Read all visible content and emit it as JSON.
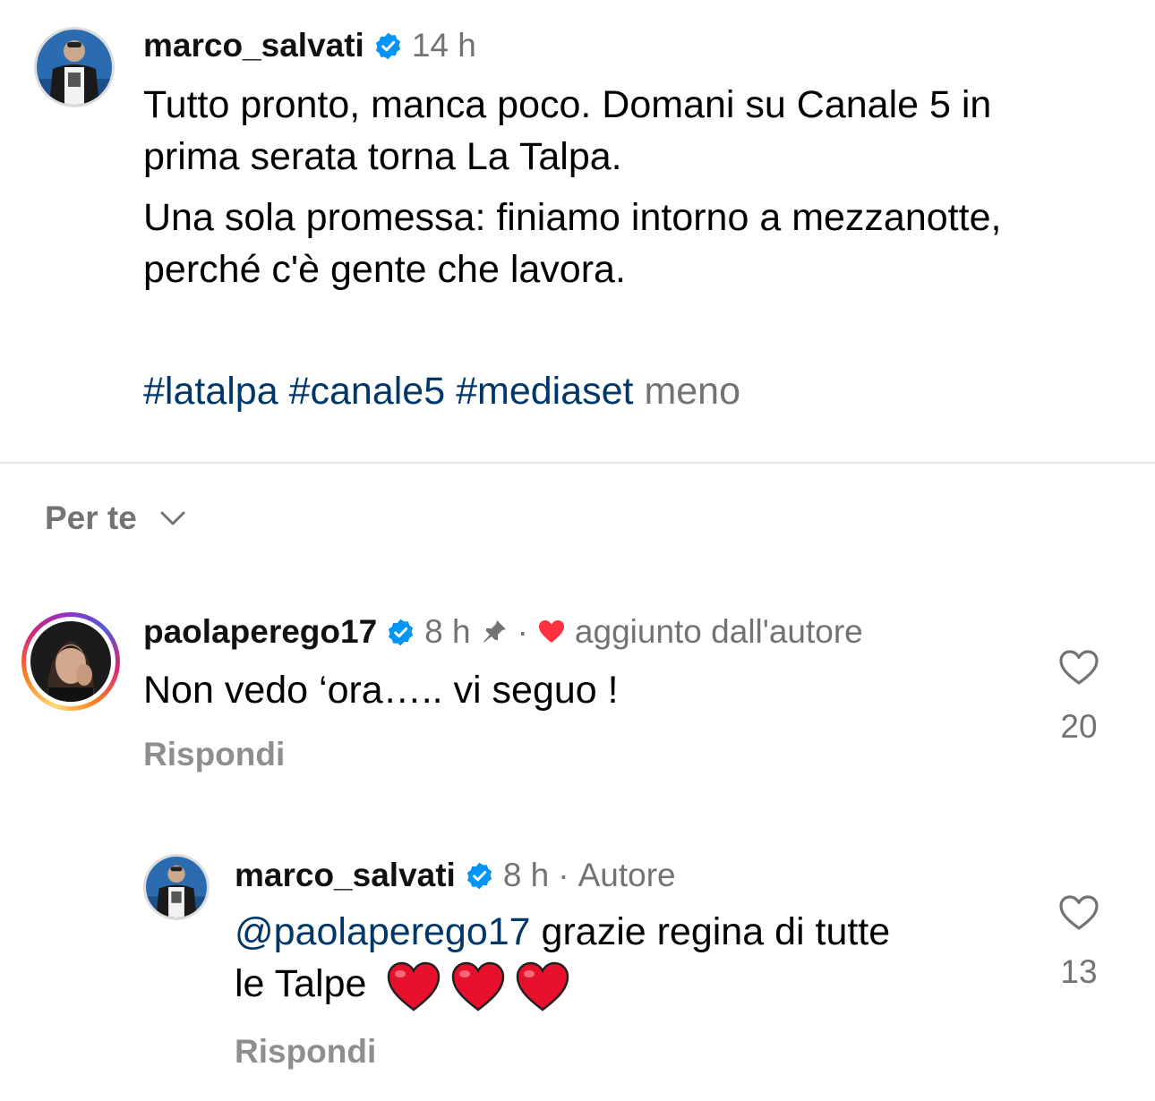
{
  "colors": {
    "verified_blue": "#0095f6",
    "hashtag_blue": "#00376b",
    "muted_gray": "#737373",
    "reply_gray": "#8e8e8e",
    "heart_red": "#ff3040"
  },
  "caption": {
    "avatar_icon": "profile-photo",
    "username": "marco_salvati",
    "verified_icon": "verified-badge-icon",
    "time": "14 h",
    "text_line1": "Tutto pronto, manca poco. Domani su Canale 5 in",
    "text_line2": "prima serata torna La Talpa.",
    "text_line3": "Una sola promessa: finiamo intorno a mezzanotte,",
    "text_line4": "perché c'è gente che lavora.",
    "hashtags": [
      "#latalpa",
      "#canale5",
      "#mediaset"
    ],
    "less_label": "meno"
  },
  "sort": {
    "label": "Per te",
    "icon": "chevron-down-icon"
  },
  "comments": [
    {
      "username": "paolaperego17",
      "time": "8 h",
      "pinned_icon": "pin-icon",
      "separator": "·",
      "heart_icon": "heart-filled-icon",
      "author_like_label": "aggiunto dall'autore",
      "text": "Non vedo ‘ora….. vi seguo !",
      "reply_label": "Rispondi",
      "like_count": "20"
    },
    {
      "username": "marco_salvati",
      "time": "8 h",
      "separator": "·",
      "author_label": "Autore",
      "mention": "@paolaperego17",
      "text_after_mention": " grazie regina di tutte",
      "text_line2": "le Talpe",
      "emoji_hearts": 3,
      "reply_label": "Rispondi",
      "like_count": "13"
    }
  ]
}
